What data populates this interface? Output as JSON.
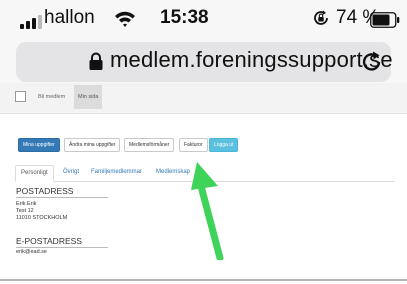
{
  "status_bar": {
    "carrier": "hallon",
    "time": "15:38",
    "battery_percent": "74 %",
    "signal_icon": "signal-bars-icon",
    "wifi_icon": "wifi-icon",
    "rotation_lock_icon": "rotation-lock-icon",
    "battery_icon": "battery-icon"
  },
  "browser": {
    "url": "medlem.foreningssupport.se",
    "lock_icon": "lock-icon",
    "reload_icon": "reload-icon"
  },
  "site_nav": {
    "items": [
      {
        "label": "Bli medlem",
        "active": false
      },
      {
        "label": "Min sida",
        "active": true
      }
    ]
  },
  "action_buttons": [
    {
      "label": "Mina uppgifter",
      "style": "primary"
    },
    {
      "label": "Ändra mina uppgifter",
      "style": "default"
    },
    {
      "label": "Medlemsförmåner",
      "style": "default"
    },
    {
      "label": "Fakturor",
      "style": "default"
    },
    {
      "label": "Logga ut",
      "style": "info"
    }
  ],
  "tabs": [
    {
      "label": "Personligt",
      "active": true
    },
    {
      "label": "Övrigt",
      "active": false
    },
    {
      "label": "Familjemedlemmar",
      "active": false
    },
    {
      "label": "Medlemskap",
      "active": false
    }
  ],
  "postal": {
    "heading": "POSTADRESS",
    "lines": [
      "Erik Erik",
      "Test 12",
      "11010 STOCKHOLM"
    ]
  },
  "email": {
    "heading": "E-POSTADRESS",
    "value": "erik@ead.se"
  },
  "annotation": {
    "arrow_icon": "arrow-up-icon",
    "color": "#3fd35a"
  }
}
